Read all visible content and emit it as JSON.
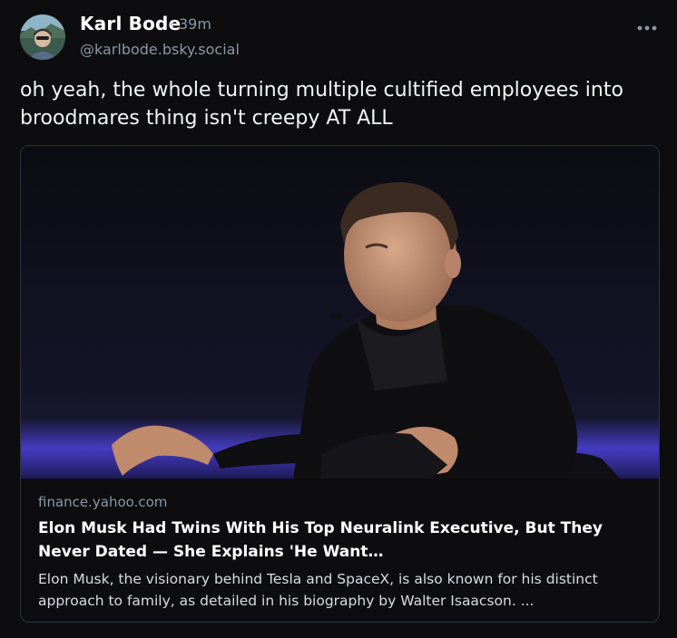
{
  "post": {
    "author_name": "Karl Bode",
    "separator": "·",
    "time_ago": "39m",
    "handle": "@karlbode.bsky.social",
    "more_icon": "more-horizontal-icon",
    "text": "oh yeah, the whole turning multiple cultified employees into broodmares thing isn't creepy AT ALL"
  },
  "link_card": {
    "domain": "finance.yahoo.com",
    "title": "Elon Musk Had Twins With His Top Neuralink Executive, But They Never Dated — She Explains 'He Want…",
    "description": "Elon Musk, the visionary behind Tesla and SpaceX, is also known for his distinct approach to family, as detailed in his biography by Walter Isaacson. ..."
  },
  "colors": {
    "background": "#0d0d0f",
    "muted_text": "#8a96a6",
    "card_border": "#2b333d",
    "stage_glow": "#4a3fd0"
  }
}
